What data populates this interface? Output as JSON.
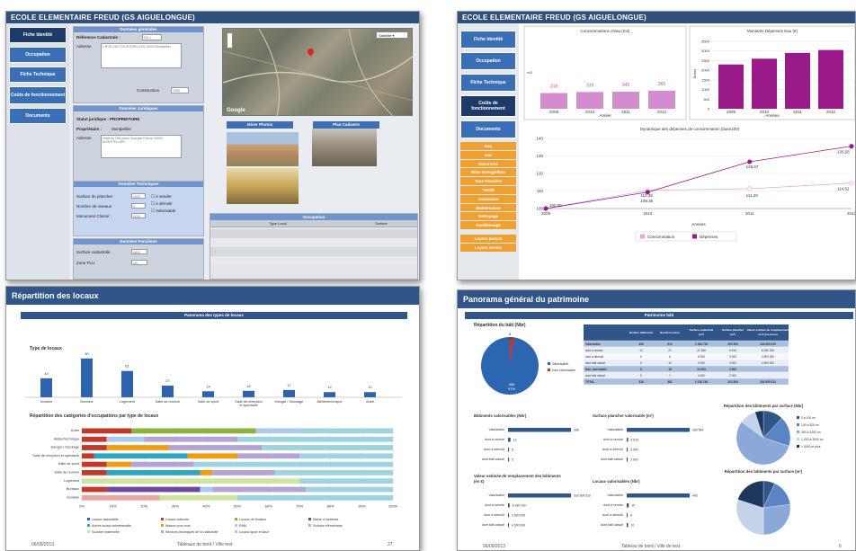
{
  "panel1": {
    "title": "ECOLE ELEMENTAIRE FREUD (GS AIGUELONGUE)",
    "nav": [
      "Fiche Identité",
      "Occupation",
      "Fiche Technique",
      "Coûts de fonctionnement",
      "Documents"
    ],
    "gen": {
      "header": "Données générales",
      "ref_label": "Référence Cadastrale :",
      "ref_value": "DN 1",
      "adr_label": "Adresse",
      "adr_value": "2 RUE DES FOURTERELLES 34000 Montpellier",
      "constr_label": "Construction",
      "constr_value": "1969"
    },
    "jur": {
      "header": "Données Juridiques",
      "statut": "Statut juridique : PROPRIETAIRE",
      "prop_label": "Propriétaire :",
      "prop_value": "Montpellier",
      "adr_label": "Adresse",
      "adr_value": "Hôtel de Ville place Georges Frêche 34000 MONTPELLIER"
    },
    "tech": {
      "header": "Données Techniques",
      "surf_label": "Surface de plancher",
      "surf_value": "1003",
      "niv_label": "Nombre de niveaux",
      "niv_value": "3",
      "mon_label": "Monument Classé :",
      "mon_value": "NON",
      "cb": [
        "A vendre",
        "A démolir",
        "Valorisable"
      ]
    },
    "fonc": {
      "header": "Données Foncières",
      "surf_label": "Surface cadastrale",
      "surf_value": "6840",
      "zone_label": "Zone PLU",
      "zone_value": "UA"
    },
    "map": {
      "type_btn": "Satellite",
      "logo": "Google"
    },
    "photos_btn": "Gérer Photos",
    "plan_btn": "Plan Cadastre",
    "occ": {
      "header": "Occupation",
      "col1": "Type Local",
      "col2": "Surface"
    }
  },
  "panel2": {
    "title": "ECOLE ELEMENTAIRE FREUD (GS AIGUELONGUE)",
    "nav": [
      "Fiche Identité",
      "Occupation",
      "Fiche Technique",
      "Coûts de fonctionnement",
      "Documents"
    ],
    "orange": [
      "Eau",
      "Gaz",
      "Electricité",
      "Bilan Energie/Eau",
      "Taxe Foncière",
      "TEOM",
      "Assurance",
      "Maintenance",
      "Nettoyage",
      "Gardiennage",
      "Loyers perçus",
      "Loyers versés"
    ],
    "colors": {
      "accent": "#f0a030",
      "bar": "#d38ccd",
      "dep": "#9a1a8a",
      "cons": "#e6a7df"
    }
  },
  "panel3": {
    "title": "Répartition des locaux",
    "banner": "Panorama des types de locaux",
    "sub1": "Type de locaux",
    "sub2": "Répartition des catégories d'occupations par type de locaux",
    "legend": [
      "Locaux associatifs",
      "Locaux culturels",
      "Locaux de fonction",
      "Mairie et annexes",
      "Autres locaux administratifs",
      "Maison pour tous",
      "RAM",
      "Scolaire élémentaire",
      "Scolaire maternelle",
      "Services techniques de la collectivité",
      "Locaux sport et loisir"
    ],
    "footer_date": "06/09/2013",
    "footer_text": "Tableaux de bord / Ville test",
    "footer_page": "27"
  },
  "panel4": {
    "title": "Panorama général du patrimoine",
    "banner": "Patrimoine bâti",
    "rep_title": "Répartition du bâti (Nbr)",
    "pie_legend": [
      "Valorisable",
      "Non valorisable"
    ],
    "pie_labels": [
      "8\n2%",
      "306\n97%"
    ],
    "table": {
      "headers": [
        "",
        "Nombre bâtiments",
        "Nombre locaux",
        "Surface cadastrale (m²)",
        "Surface plancher (m²)",
        "Valeur estimée de remplacement en € (en euros)"
      ],
      "rows": [
        [
          "Valorisable",
          "308",
          "910",
          "1 008 746",
          "309 594",
          "333 609 510"
        ],
        [
          "dont à vendre",
          "12",
          "21",
          "21 366",
          "6 615",
          "8 180 200"
        ],
        [
          "dont à démolir",
          "5",
          "6",
          "6 000",
          "3 000",
          "4 500 000"
        ],
        [
          "dont bâti classé",
          "5",
          "10",
          "4 000",
          "3 000",
          "4 500 000"
        ],
        [
          "Non valorisable",
          "8",
          "15",
          "10 000",
          "4 000",
          ""
        ],
        [
          "dont bâti classé",
          "5",
          "7",
          "4 000",
          "2 000",
          ""
        ],
        [
          "TOTAL",
          "316",
          "481",
          "1 018 746",
          "313 594",
          "333 609 510"
        ]
      ]
    },
    "bv_title": "Bâtiments valorisables (Nbr)",
    "sp_title": "Surface plancher valorisable (m²)",
    "rp1_title": "Répartition des bâtiments par surface (Nbr)",
    "rp2_title": "Répartition des bâtiments par surface (m²)",
    "ve_title": "Valeur estimée de remplacement des bâtiments (en €)",
    "lv_title": "Locaux valorisables (Nbr)",
    "rows": [
      "Valorisable",
      "dont à vendre",
      "dont à démolir",
      "dont bâti classé"
    ],
    "bv_vals": [
      "308",
      "12",
      "5",
      "5"
    ],
    "sp_vals": [
      "309 594",
      "6 615",
      "3 000",
      "3 000"
    ],
    "ve_vals": [
      "333 609 510",
      "8 180 200",
      "4 500 000",
      "4 500 000"
    ],
    "lv_vals": [
      "466",
      "15",
      "6",
      "10"
    ],
    "rp_legend": [
      "0 à 100 m²",
      "100 à 300 m²",
      "300 à 1000 m²",
      "1 000 à 3000 m²",
      "> 3000 et plus"
    ],
    "footer_date": "06/09/2013",
    "footer_text": "Tableau de bord / ville de test",
    "footer_page": "6"
  },
  "chart_data": [
    {
      "type": "bar",
      "title": "Consommations d'eau (m3)",
      "ylabel": "m3",
      "xlabel": "Année",
      "categories": [
        "2009",
        "2010",
        "2011",
        "2012"
      ],
      "values": [
        318,
        339,
        345,
        365
      ]
    },
    {
      "type": "bar",
      "title": "Montants Dépenses Eau (€)",
      "ylabel": "Euros",
      "xlabel": "Années",
      "categories": [
        "2009",
        "2010",
        "2011",
        "2012"
      ],
      "values": [
        2300,
        2600,
        2900,
        3050
      ],
      "ylim": [
        0,
        3500
      ]
    },
    {
      "type": "line",
      "title": "Dynamique des dépenses de consommation (base100)",
      "xlabel": "Années",
      "x": [
        "2009",
        "2010",
        "2011",
        "2012"
      ],
      "ylim": [
        100,
        140
      ],
      "series": [
        {
          "name": "Consommation",
          "values": [
            100,
            110.38,
            111.29,
            114.52
          ]
        },
        {
          "name": "Dépenses",
          "values": [
            100,
            109.35,
            126.67,
            135.56
          ]
        }
      ],
      "labels": [
        "100,00",
        "110,38",
        "109,35",
        "126,67",
        "111,29",
        "135,56",
        "114,52"
      ]
    },
    {
      "type": "bar",
      "title": "Type de locaux",
      "categories": [
        "Scolaire",
        "Bureaux",
        "Logement",
        "Salle de réunion",
        "Salle de sport",
        "Salle de réception et spectacle",
        "Hangar / Stockage",
        "Atelier/technique",
        "Autre"
      ],
      "values": [
        44,
        90,
        61,
        27,
        14,
        15,
        17,
        12,
        12
      ],
      "legend": [
        "Bureaux",
        "Logement",
        "Salle de réunion",
        "Salle de sport",
        "Salle de réception et spectacle",
        "Hangar/stockage",
        "Atelier/technique",
        "Autre"
      ]
    },
    {
      "type": "bar",
      "title": "Répartition des catégories d'occupations par type de locaux",
      "categories": [
        "Autre",
        "Atelier/technique",
        "Hangar / Stockage",
        "Salle de réception et spectacle",
        "Salle de sport",
        "Salle de réunion",
        "Logement",
        "Bureaux",
        "Scolaire"
      ],
      "xlim": [
        0,
        100
      ],
      "xticks": [
        "0%",
        "10%",
        "20%",
        "30%",
        "40%",
        "50%",
        "60%",
        "70%",
        "80%",
        "90%",
        "100%"
      ]
    },
    {
      "type": "pie",
      "title": "Répartition du bâti (Nbr)",
      "labels": [
        "Valorisable",
        "Non valorisable"
      ],
      "values": [
        306,
        8
      ]
    },
    {
      "type": "bar",
      "title": "Bâtiments valorisables (Nbr)",
      "categories": [
        "Valorisable",
        "dont à vendre",
        "dont à démolir",
        "dont bâti classé"
      ],
      "values": [
        308,
        12,
        5,
        5
      ]
    },
    {
      "type": "bar",
      "title": "Surface plancher valorisable (m²)",
      "categories": [
        "Valorisable",
        "dont à vendre",
        "dont à démolir",
        "dont bâti classé"
      ],
      "values": [
        309594,
        6615,
        3000,
        3000
      ]
    },
    {
      "type": "bar",
      "title": "Valeur estimée de remplacement des bâtiments (en €)",
      "categories": [
        "Valorisable",
        "dont à vendre",
        "dont à démolir",
        "dont bâti classé"
      ],
      "values": [
        333609510,
        8180200,
        4500000,
        4500000
      ]
    },
    {
      "type": "bar",
      "title": "Locaux valorisables (Nbr)",
      "categories": [
        "Valorisable",
        "dont à vendre",
        "dont à démolir",
        "dont bâti classé"
      ],
      "values": [
        466,
        15,
        6,
        10
      ]
    }
  ]
}
